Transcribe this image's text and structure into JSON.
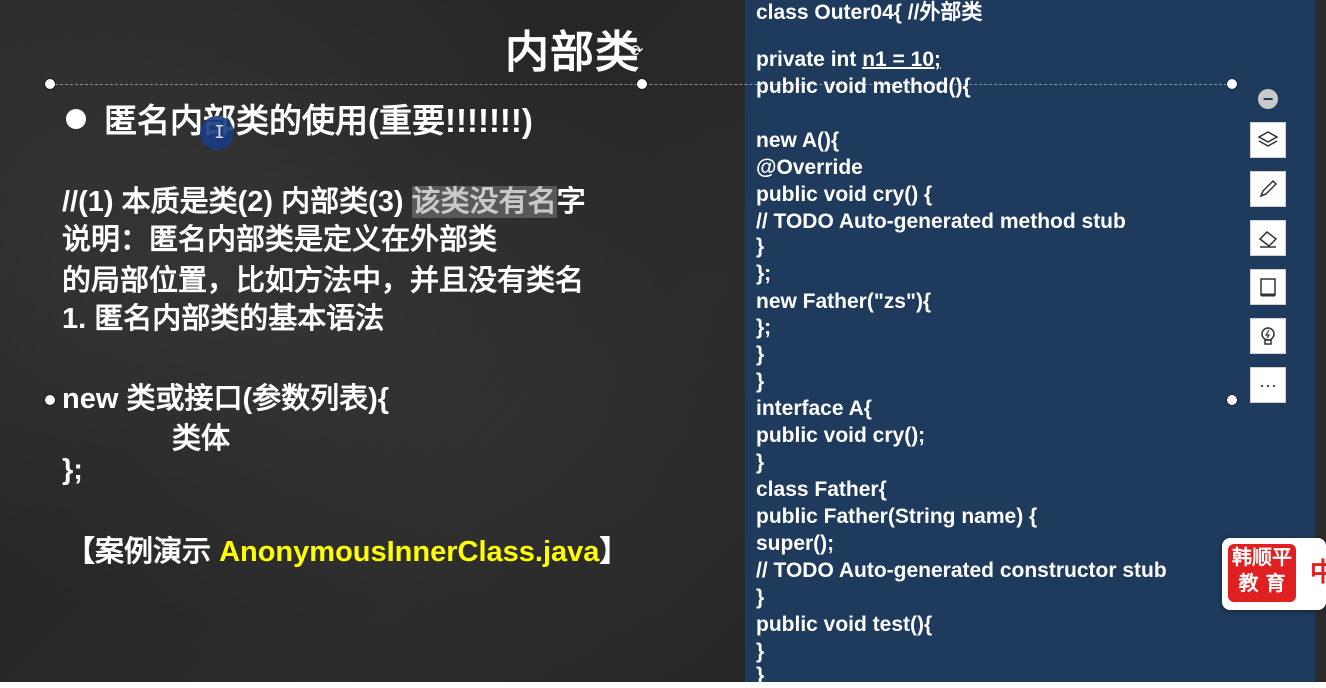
{
  "slide": {
    "title": "内部类",
    "heading": "匿名内部类的使用(重要!!!!!!!)",
    "lines": {
      "l1_a": "//(1) 本质是类(2) 内部类(3) ",
      "l1_hl": "该类没有名",
      "l1_b": "字",
      "l2": "说明：匿名内部类是定义在外部类",
      "l3": "的局部位置，比如方法中，并且没有类名",
      "l4": "1. 匿名内部类的基本语法",
      "l5": "new 类或接口(参数列表){",
      "l6": "类体",
      "l7": "};",
      "l8_a": "【案例演示 ",
      "l8_y": "AnonymousInnerClass.java",
      "l8_b": "】"
    }
  },
  "code": {
    "c0": "class Outer04{ //外部类",
    "c1_a": "private int ",
    "c1_u": "n1 = 10;",
    "c2": "public void method(){",
    "c3": "new A(){",
    "c4": "@Override",
    "c5": "public void cry() {",
    "c6": "// TODO Auto-generated method stub",
    "c7": "}",
    "c8": "};",
    "c9": "new Father(\"zs\"){",
    "c10": "};",
    "c11": "}",
    "c12": "}",
    "c13": "interface A{",
    "c14": "public void cry();",
    "c15": "}",
    "c16": "class Father{",
    "c17": "public Father(String name) {",
    "c18": "super();",
    "c19": "// TODO Auto-generated constructor stub",
    "c20": "}",
    "c21": "public void test(){",
    "c22": "}",
    "c23": "}"
  },
  "toolbar": {
    "minus": "−",
    "icons": [
      "layers-icon",
      "pen-icon",
      "eraser-icon",
      "frame-icon",
      "lightbulb-icon",
      "more-icon"
    ],
    "more": "···"
  },
  "logo": {
    "line1": "韩顺平",
    "line2": "教 育",
    "side": "中"
  },
  "colors": {
    "board": "#2b2b2b",
    "code_panel": "#1e3a5c",
    "highlight_text": "#ffff00",
    "logo_red": "#e02020"
  }
}
